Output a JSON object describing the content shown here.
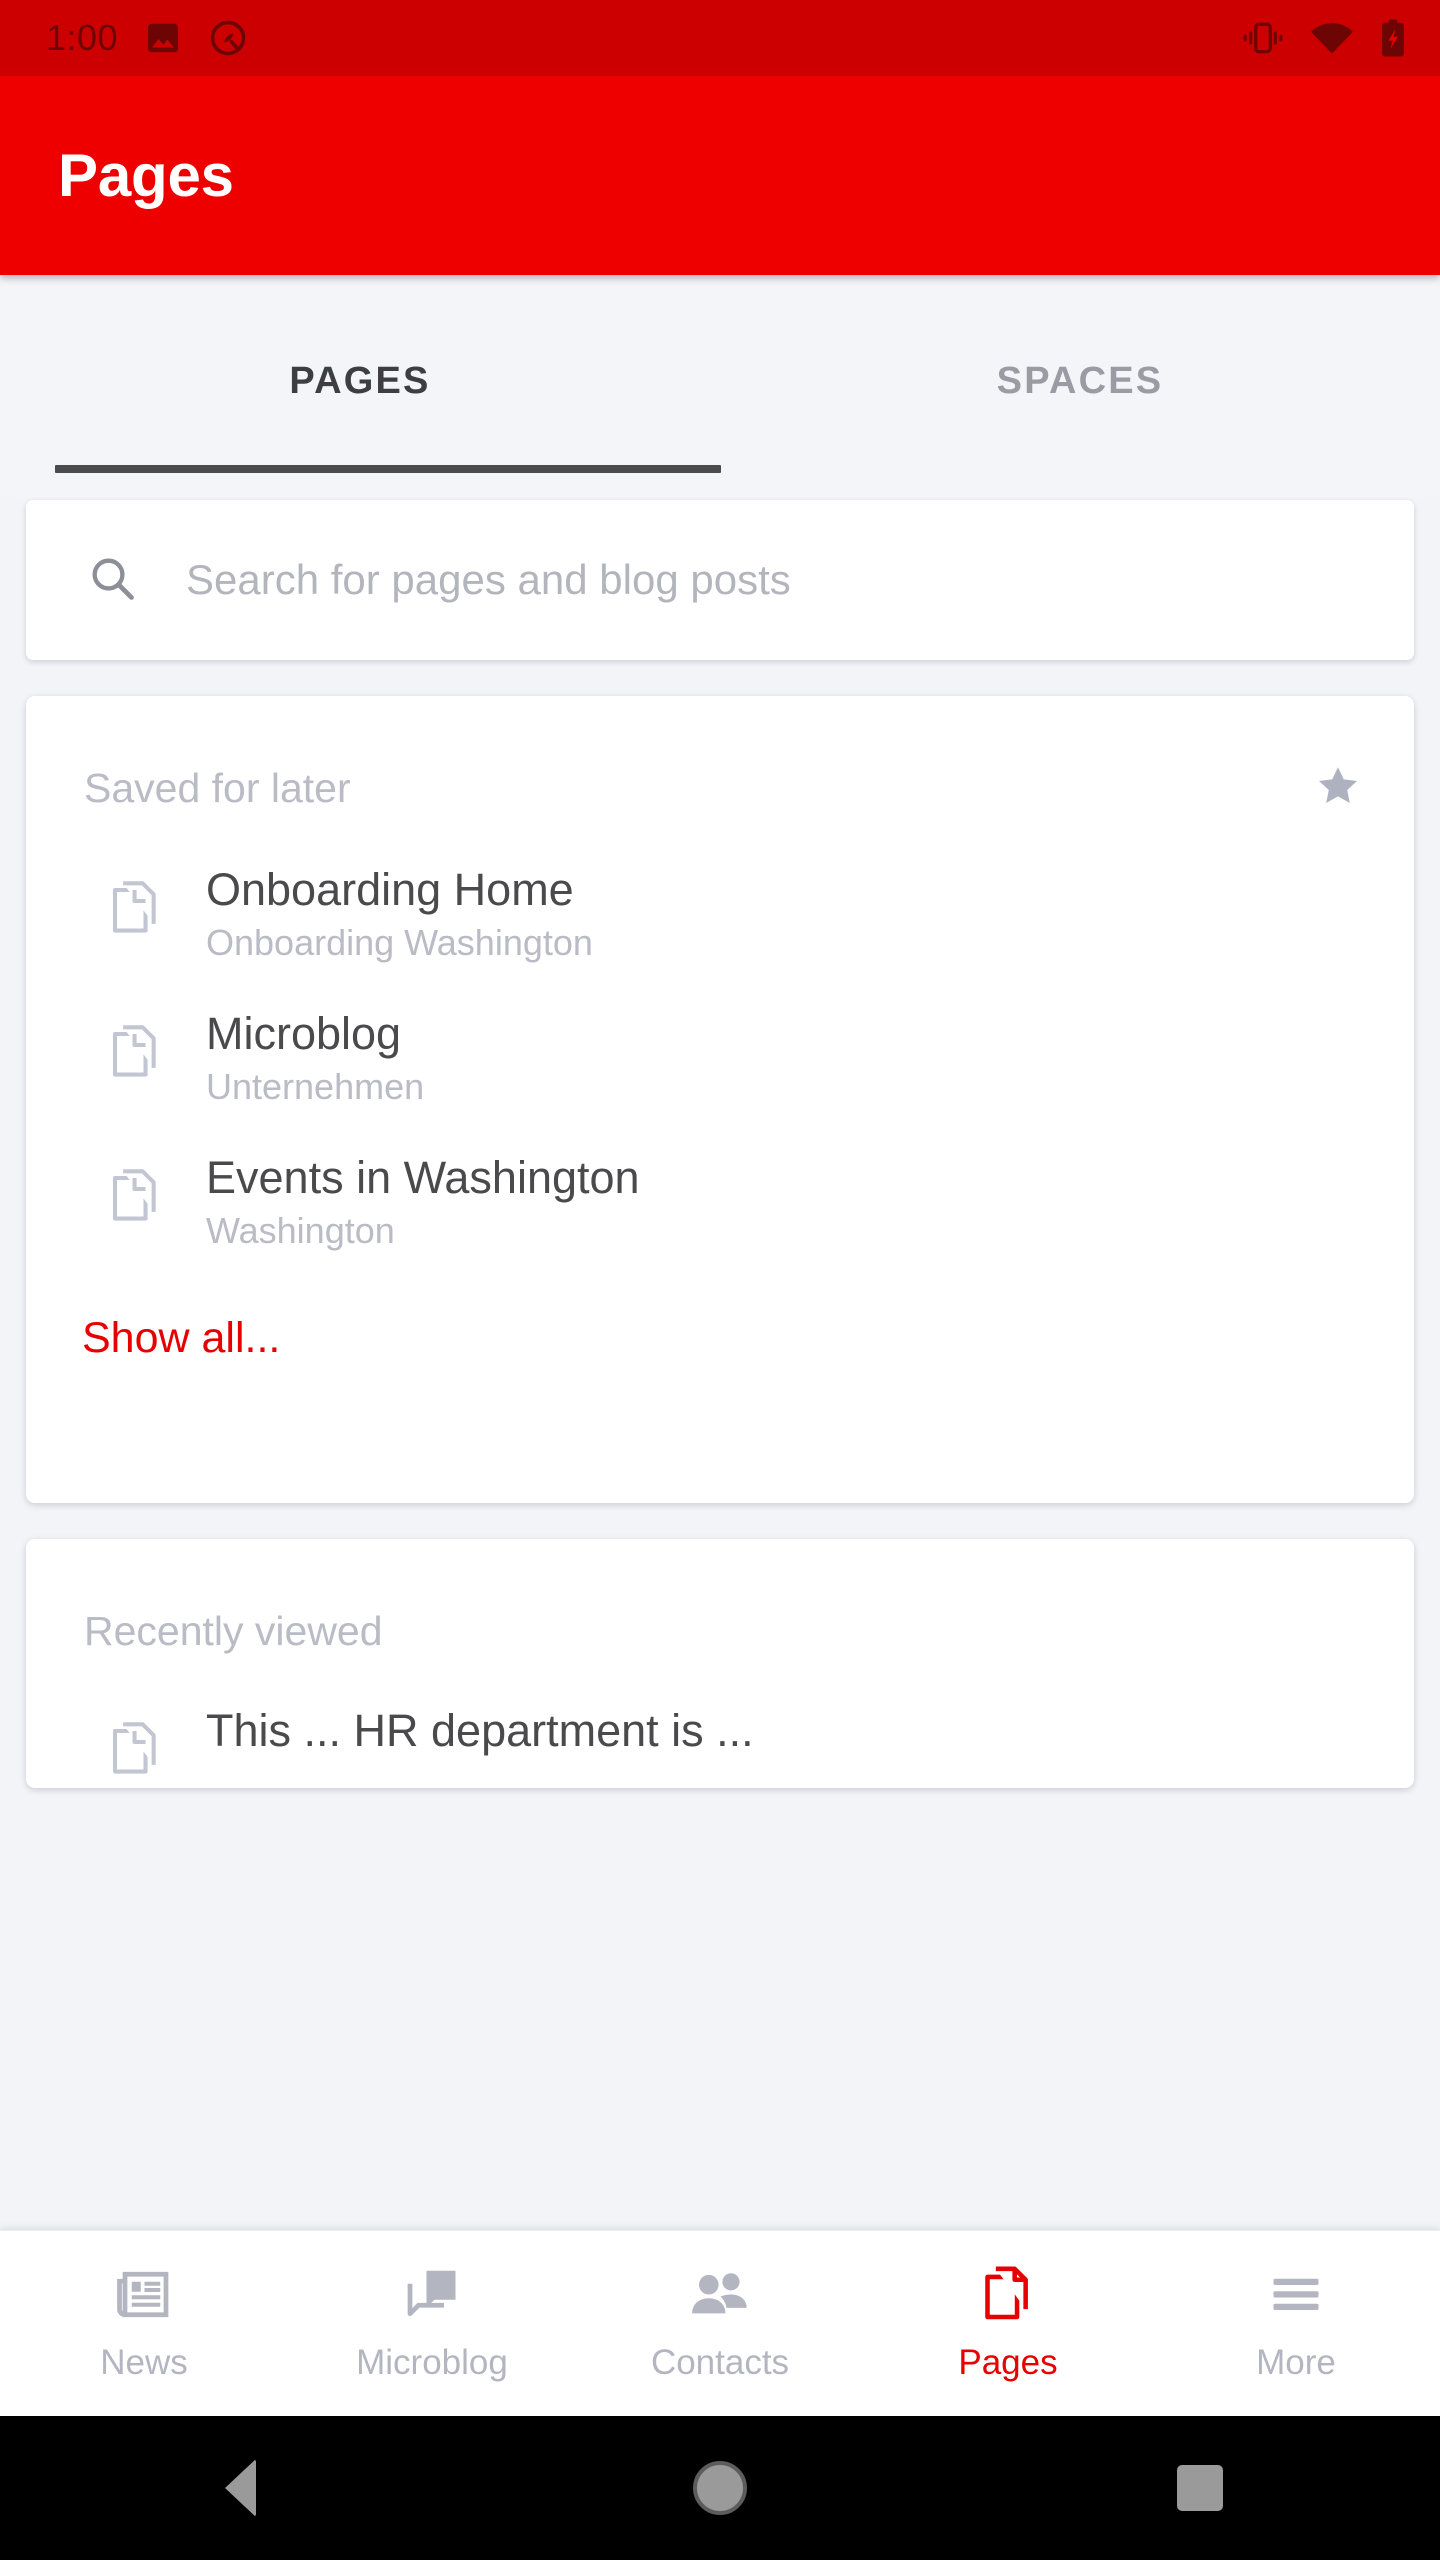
{
  "status_bar": {
    "time": "1:00",
    "left_icons": [
      "image-icon",
      "android-q-icon"
    ],
    "right_icons": [
      "vibrate-icon",
      "wifi-icon",
      "battery-charging-icon"
    ],
    "background_color": "#cc0000"
  },
  "app_bar": {
    "title": "Pages",
    "background_color": "#ee0000",
    "title_color": "#ffffff"
  },
  "tabs": {
    "items": [
      {
        "label": "PAGES",
        "active": true
      },
      {
        "label": "SPACES",
        "active": false
      }
    ],
    "indicator_color": "#4a4a4d"
  },
  "search": {
    "icon": "search-icon",
    "placeholder": "Search for pages and blog posts",
    "value": ""
  },
  "saved_card": {
    "title": "Saved for later",
    "star_icon": "star-filled-icon",
    "items": [
      {
        "icon": "page-copy-icon",
        "title": "Onboarding Home",
        "subtitle": "Onboarding Washington"
      },
      {
        "icon": "page-copy-icon",
        "title": "Microblog",
        "subtitle": "Unternehmen"
      },
      {
        "icon": "page-copy-icon",
        "title": "Events in Washington",
        "subtitle": "Washington"
      }
    ],
    "show_all_label": "Show all...",
    "show_all_color": "#e60000"
  },
  "recent_card": {
    "title": "Recently viewed",
    "items": [
      {
        "icon": "page-copy-icon",
        "title": "This ... HR department is ..."
      }
    ]
  },
  "bottom_nav": {
    "items": [
      {
        "label": "News",
        "icon": "newspaper-icon",
        "active": false
      },
      {
        "label": "Microblog",
        "icon": "chat-bubble-icon",
        "active": false
      },
      {
        "label": "Contacts",
        "icon": "people-icon",
        "active": false
      },
      {
        "label": "Pages",
        "icon": "page-copy-icon",
        "active": true
      },
      {
        "label": "More",
        "icon": "hamburger-menu-icon",
        "active": false
      }
    ],
    "active_color": "#e60000",
    "inactive_color": "#b3b6c0"
  },
  "android_nav": {
    "buttons": [
      "back-button",
      "home-button",
      "recents-button"
    ],
    "background_color": "#000000"
  }
}
